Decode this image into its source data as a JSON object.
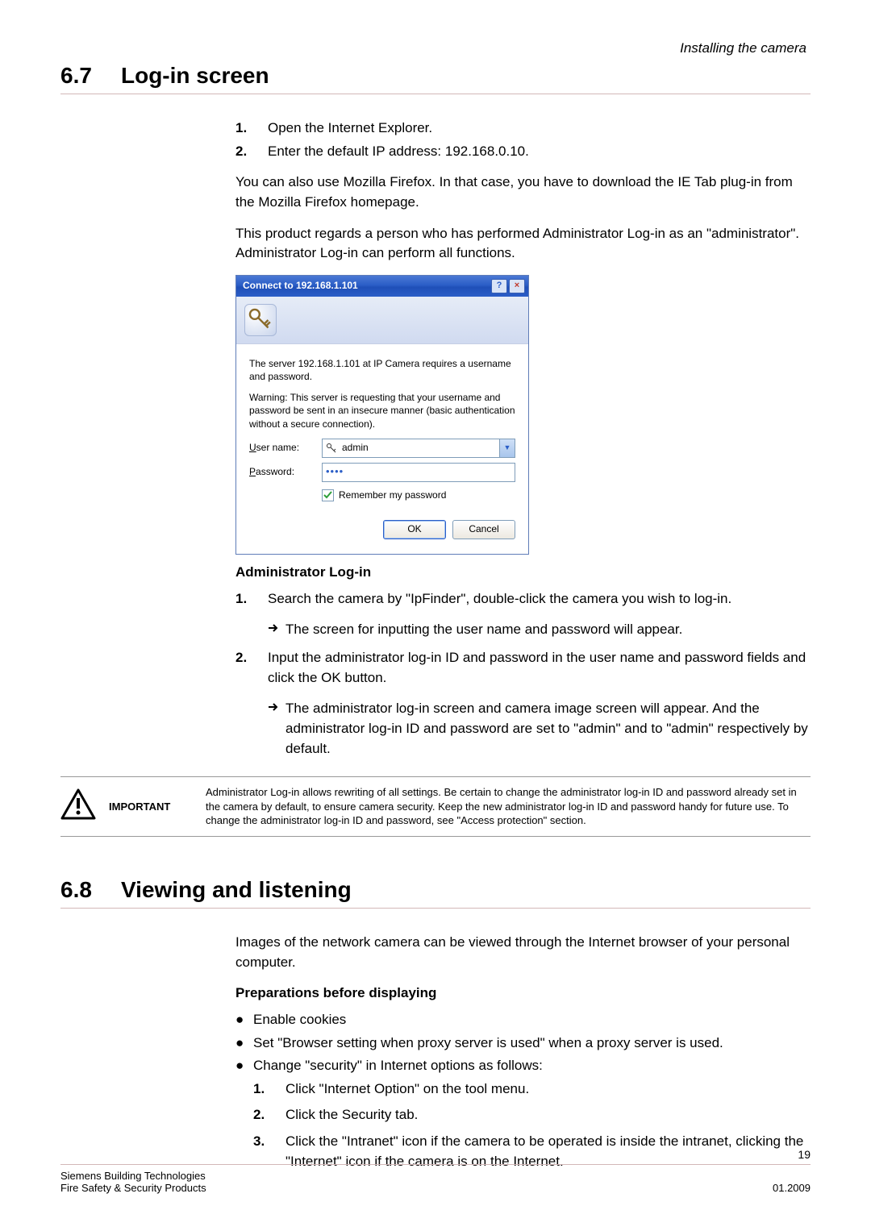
{
  "header": {
    "context": "Installing the camera"
  },
  "sec1": {
    "num": "6.7",
    "title": "Log-in screen",
    "steps": [
      {
        "n": "1.",
        "t": "Open the Internet Explorer."
      },
      {
        "n": "2.",
        "t": "Enter the default IP address: 192.168.0.10."
      }
    ],
    "p1": "You can also use Mozilla Firefox. In that case, you have to download the IE Tab plug-in from the Mozilla Firefox homepage.",
    "p2": "This product regards a person who has performed Administrator Log-in as an \"administrator\". Administrator Log-in can perform all functions."
  },
  "dialog": {
    "title": "Connect to 192.168.1.101",
    "help": "?",
    "close": "×",
    "text1": "The server 192.168.1.101 at IP Camera requires a username and password.",
    "text2": "Warning: This server is requesting that your username and password be sent in an insecure manner (basic authentication without a secure connection).",
    "user_label_pre": "U",
    "user_label_post": "ser name:",
    "user_value": "admin",
    "pw_label_pre": "P",
    "pw_label_post": "assword:",
    "pw_value": "••••",
    "remember_pre": "R",
    "remember_post": "emember my password",
    "ok": "OK",
    "cancel": "Cancel"
  },
  "admin": {
    "head": "Administrator Log-in",
    "s1n": "1.",
    "s1t": "Search the camera by \"IpFinder\", double-click the camera you wish to log-in.",
    "s1r": "The screen for inputting the user name and password will appear.",
    "s2n": "2.",
    "s2t": "Input the administrator log-in ID and password in the user name and password fields and click the OK button.",
    "s2r": "The administrator log-in screen and camera image screen will appear. And the administrator log-in ID and password are set to \"admin\" and to \"admin\" respectively by default."
  },
  "important": {
    "label": "IMPORTANT",
    "text": "Administrator Log-in allows rewriting of all settings. Be certain to change the administrator log-in ID and password already set in the camera by default, to ensure camera security. Keep the new administrator log-in ID and password handy for future use. To change the administrator log-in ID and password, see \"Access protection\" section."
  },
  "sec2": {
    "num": "6.8",
    "title": "Viewing and listening",
    "p1": "Images of the network camera can be viewed through the Internet browser of your personal computer.",
    "prep_head": "Preparations before displaying",
    "b1": "Enable cookies",
    "b2": "Set \"Browser setting when proxy server is used\" when a proxy server is used.",
    "b3": "Change \"security\" in Internet options as follows:",
    "n1n": "1.",
    "n1t": "Click \"Internet Option\" on the tool menu.",
    "n2n": "2.",
    "n2t": "Click the Security tab.",
    "n3n": "3.",
    "n3t": "Click the \"Intranet\" icon if the camera to be operated is inside the intranet, clicking the \"Internet\" icon if the camera is on the Internet."
  },
  "footer": {
    "page": "19",
    "l1": "Siemens Building Technologies",
    "l2": "Fire Safety & Security Products",
    "date": "01.2009"
  }
}
